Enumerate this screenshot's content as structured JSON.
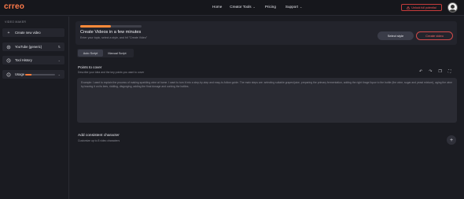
{
  "brand": {
    "logo": "crreo",
    "accent": "#ff7b4a"
  },
  "nav": {
    "home": "Home",
    "creator_tools": "Creator Tools",
    "pricing": "Pricing",
    "support": "Support",
    "unlock": "Unlock full potential",
    "unlock_icon": "lock-icon"
  },
  "sidebar": {
    "header": "VIDEO MAKER",
    "items": [
      {
        "label": "Create new video",
        "icon": "plus-icon"
      },
      {
        "label": "YouTube (generic)",
        "icon": "settings-icon",
        "trail": "⇅"
      },
      {
        "label": "Tool History",
        "icon": "history-icon",
        "trail": "⌄"
      },
      {
        "label": "Usage",
        "icon": "info-icon",
        "trail": "⌄",
        "progress": 0.2
      }
    ]
  },
  "top_card": {
    "progress": 0.5,
    "title": "Create Videos in a few minutes",
    "subtitle": "Enter your topic, select a style, and hit \"Create Video\"",
    "select_style": "Select style",
    "create_video": "Create video"
  },
  "tabs": [
    {
      "label": "Auto Script",
      "active": true
    },
    {
      "label": "Manual Script",
      "active": false
    }
  ],
  "points": {
    "title": "Points to cover",
    "subtitle": "Describe your idea and the key points you want to cover",
    "placeholder": "Example: I want to explain the process of making sparkling wine at home. I want to turn it into a step-by-step and easy-to-follow guide. The main steps are: selecting suitable grapes/juice, preparing the primary fermentation, adding the right tirage liquor to the bottle (the wine, sugar and yeast mixture), aging the wine by leaving it on its lees, riddling, disgorging, adding the final dosage and corking the bottles."
  },
  "character": {
    "title": "Add consistent character",
    "subtitle": "Customize up to 8 video characters"
  }
}
